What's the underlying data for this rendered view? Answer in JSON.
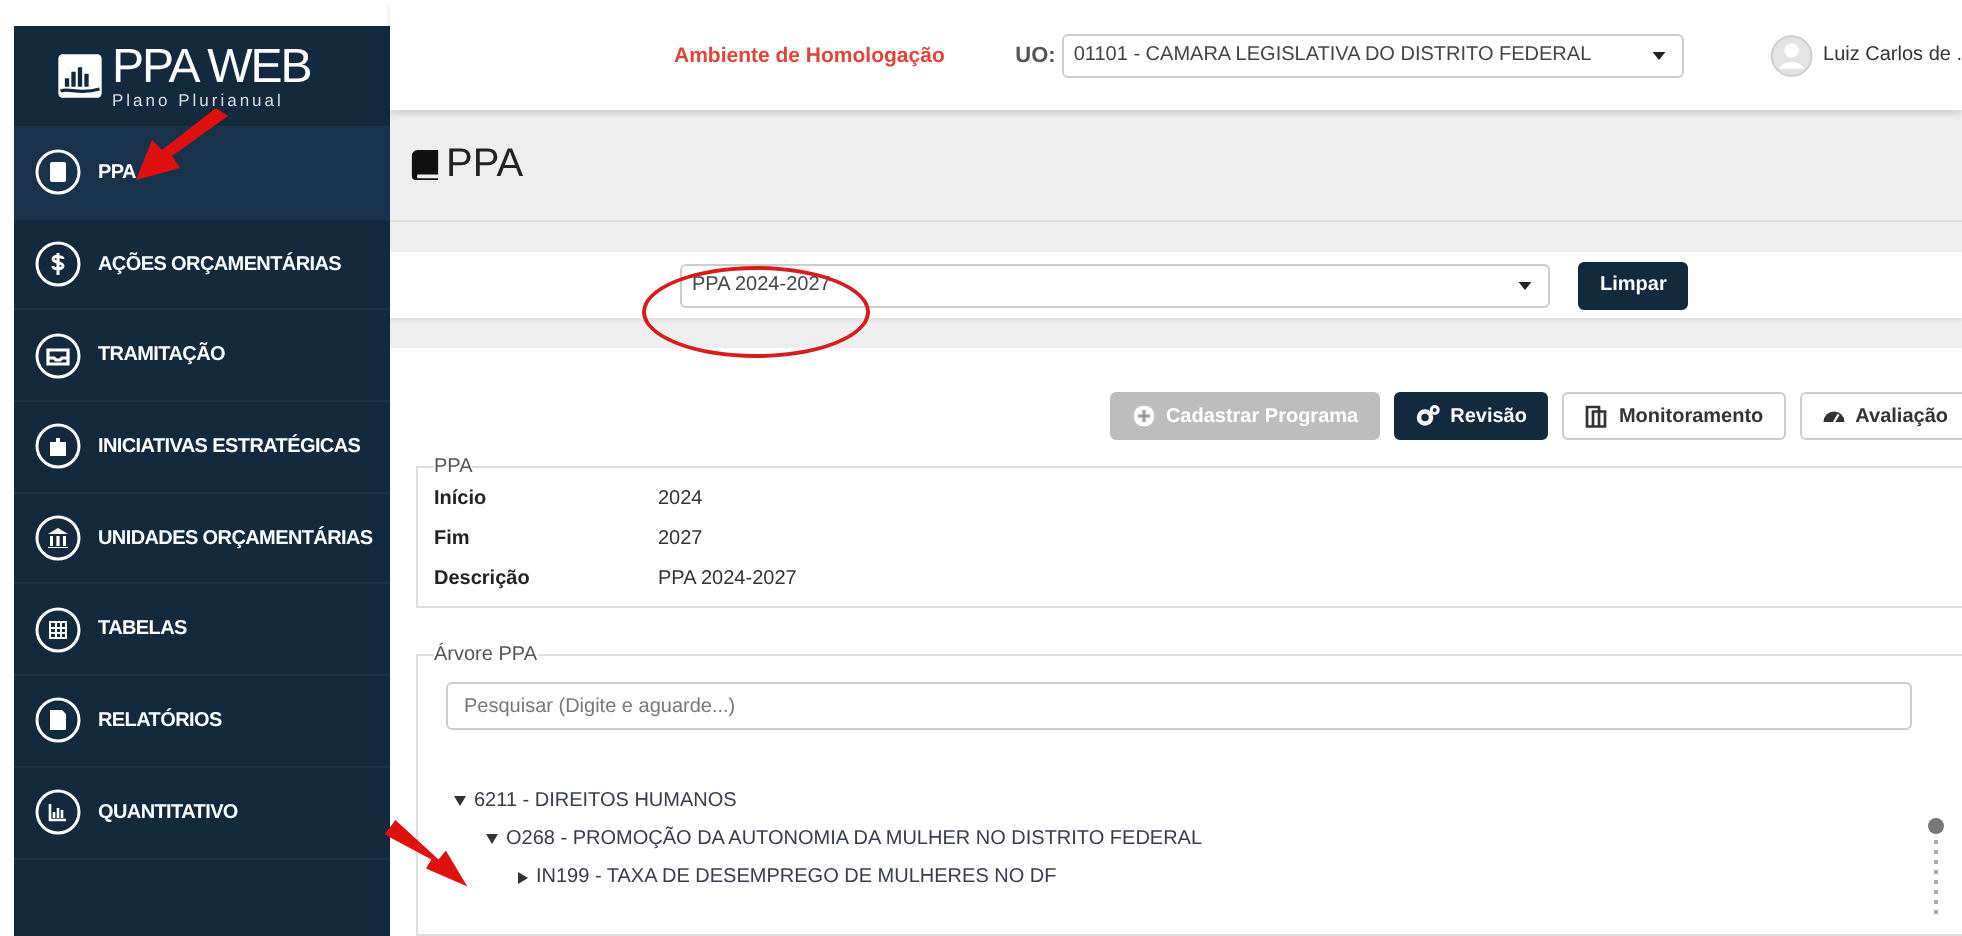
{
  "logo": {
    "title": "PPA WEB",
    "subtitle": "Plano Plurianual"
  },
  "sidebar": {
    "items": [
      {
        "label": "PPA",
        "selected": true
      },
      {
        "label": "AÇÕES ORÇAMENTÁRIAS",
        "selected": false
      },
      {
        "label": "TRAMITAÇÃO",
        "selected": false
      },
      {
        "label": "INICIATIVAS ESTRATÉGICAS",
        "selected": false
      },
      {
        "label": "UNIDADES ORÇAMENTÁRIAS",
        "selected": false
      },
      {
        "label": "TABELAS",
        "selected": false
      },
      {
        "label": "RELATÓRIOS",
        "selected": false
      },
      {
        "label": "QUANTITATIVO",
        "selected": false
      }
    ]
  },
  "header": {
    "environment": "Ambiente de Homologação",
    "uo_label": "UO:",
    "uo_value": "01101 - CAMARA LEGISLATIVA DO DISTRITO FEDERAL",
    "user": "Luiz Carlos de ."
  },
  "page_title": "PPA",
  "filter": {
    "value": "PPA 2024-2027",
    "button": "Limpar"
  },
  "actions": [
    {
      "label": "Cadastrar Programa",
      "kind": "disabled"
    },
    {
      "label": "Revisão",
      "kind": "primary"
    },
    {
      "label": "Monitoramento",
      "kind": "default"
    },
    {
      "label": "Avaliação",
      "kind": "default"
    }
  ],
  "ppa": {
    "legend": "PPA",
    "fields": [
      {
        "label": "Início",
        "value": "2024"
      },
      {
        "label": "Fim",
        "value": "2027"
      },
      {
        "label": "Descrição",
        "value": "PPA 2024-2027"
      }
    ]
  },
  "tree": {
    "legend": "Árvore PPA",
    "search_placeholder": "Pesquisar (Digite e aguarde...)",
    "nodes": [
      {
        "label": "6211 - DIREITOS HUMANOS",
        "expanded": true,
        "children": [
          {
            "label": "O268 - PROMOÇÃO DA AUTONOMIA DA MULHER NO DISTRITO FEDERAL",
            "expanded": true,
            "children": [
              {
                "label": "IN199 - TAXA DE DESEMPREGO DE MULHERES NO DF",
                "expanded": false
              }
            ]
          }
        ]
      }
    ]
  }
}
